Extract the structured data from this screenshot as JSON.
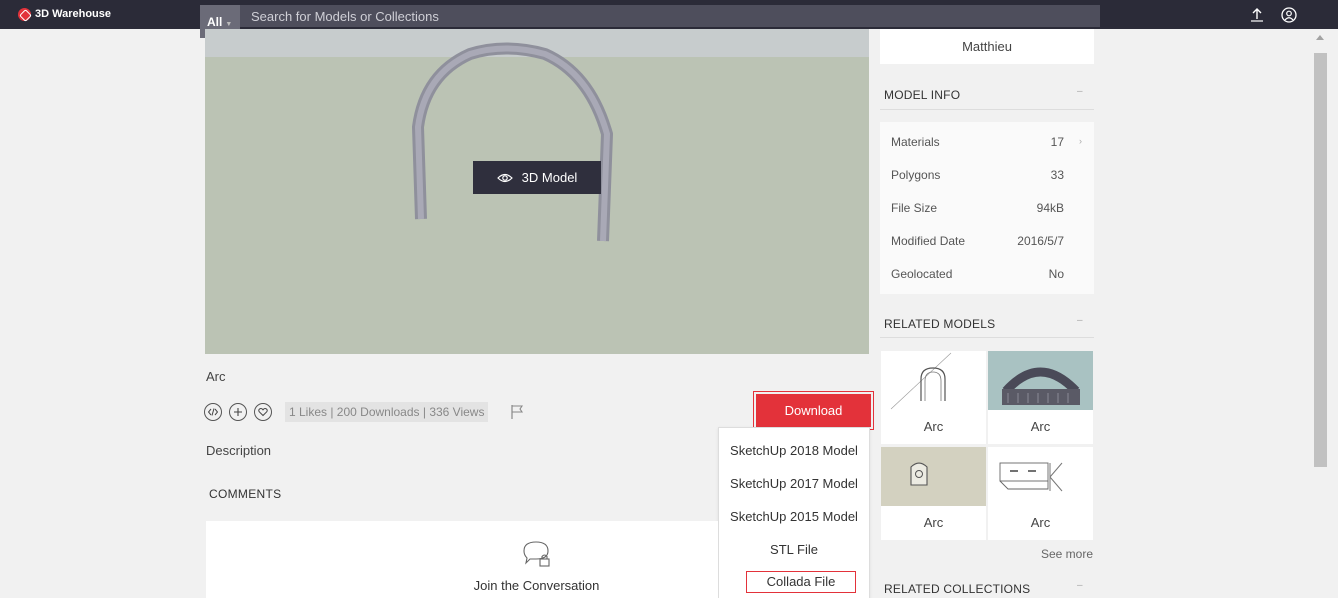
{
  "header": {
    "brand": "3D Warehouse",
    "search_scope": "All",
    "search_placeholder": "Search for Models or Collections"
  },
  "viewer": {
    "button_label": "3D Model"
  },
  "model": {
    "title": "Arc",
    "stats": "1 Likes | 200 Downloads | 336 Views",
    "download_label": "Download",
    "description_label": "Description"
  },
  "download_menu": [
    "SketchUp 2018 Model",
    "SketchUp 2017 Model",
    "SketchUp 2015 Model",
    "STL File",
    "Collada File"
  ],
  "comments": {
    "heading": "COMMENTS",
    "join_text": "Join the Conversation"
  },
  "sidebar": {
    "author": "Matthieu",
    "model_info_heading": "MODEL INFO",
    "model_info": [
      {
        "label": "Materials",
        "value": "17"
      },
      {
        "label": "Polygons",
        "value": "33"
      },
      {
        "label": "File Size",
        "value": "94kB"
      },
      {
        "label": "Modified Date",
        "value": "2016/5/7"
      },
      {
        "label": "Geolocated",
        "value": "No"
      }
    ],
    "related_models_heading": "RELATED MODELS",
    "related_models": [
      {
        "label": "Arc"
      },
      {
        "label": "Arc"
      },
      {
        "label": "Arc"
      },
      {
        "label": "Arc"
      }
    ],
    "see_more": "See more",
    "related_collections_heading": "RELATED COLLECTIONS"
  },
  "colors": {
    "accent": "#e3323a",
    "topbar": "#2b2b38"
  }
}
